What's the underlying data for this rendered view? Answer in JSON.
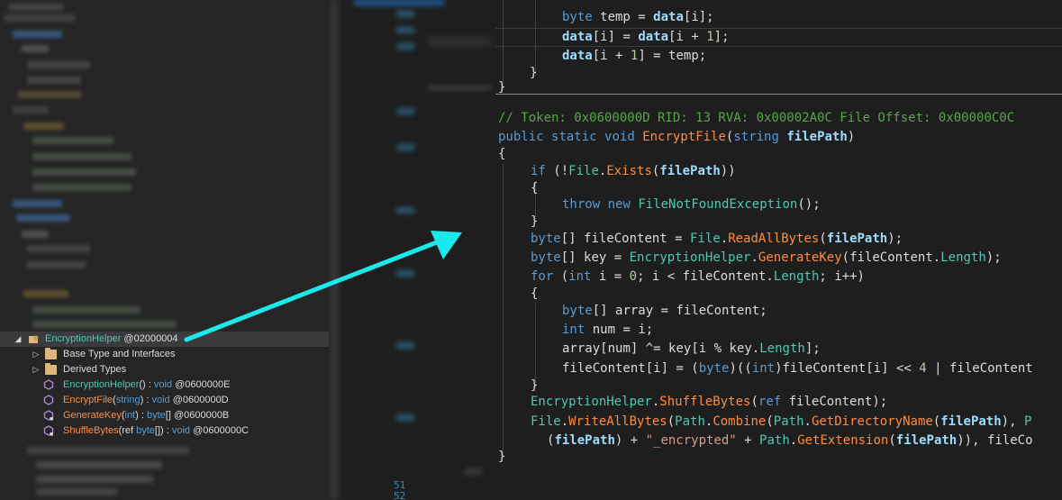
{
  "tree": {
    "nodes": [
      {
        "expander": "◢",
        "label": "EncryptionHelper",
        "suffix": " @02000004",
        "kind": "class"
      },
      {
        "expander": "▷",
        "label": "Base Type and Interfaces",
        "kind": "folder"
      },
      {
        "expander": "▷",
        "label": "Derived Types",
        "kind": "folder"
      },
      {
        "name": "EncryptionHelper",
        "args": "()",
        "sep": " : ",
        "ret": "void",
        "token": " @0600000E"
      },
      {
        "name": "EncryptFile",
        "args_open": "(",
        "args_type": "string",
        "args_close": ")",
        "sep": " : ",
        "ret": "void",
        "token": " @0600000D"
      },
      {
        "name": "GenerateKey",
        "args_open": "(",
        "args_type": "int",
        "args_close": ")",
        "sep": " : ",
        "ret": "byte",
        "ret_suffix": "[]",
        "token": " @0600000B"
      },
      {
        "name": "ShuffleBytes",
        "args_open": "(ref ",
        "args_type": "byte",
        "args_close": "[])",
        "sep": " : ",
        "ret": "void",
        "token": " @0600000C"
      }
    ]
  },
  "gutter": {
    "line_a": "51",
    "line_b": "52"
  },
  "code": {
    "l1": [
      "byte",
      " temp = ",
      "data",
      "[",
      "i",
      "];"
    ],
    "l2": [
      "data",
      "[",
      "i",
      "] = ",
      "data",
      "[",
      "i",
      " + ",
      "1",
      "];"
    ],
    "l3": [
      "data",
      "[",
      "i",
      " + ",
      "1",
      "] = ",
      "temp",
      ";"
    ],
    "l4": "}",
    "l5": "}",
    "comment": "// Token: 0x0600000D RID: 13 RVA: 0x00002A0C File Offset: 0x00000C0C",
    "sig": [
      "public",
      " ",
      "static",
      " ",
      "void",
      " ",
      "EncryptFile",
      "(",
      "string",
      " ",
      "filePath",
      ")"
    ],
    "open1": "{",
    "if": [
      "if",
      " (!",
      "File",
      ".",
      "Exists",
      "(",
      "filePath",
      "))"
    ],
    "open2": "{",
    "throw": [
      "throw",
      " ",
      "new",
      " ",
      "FileNotFoundException",
      "();"
    ],
    "close2": "}",
    "fc": [
      "byte",
      "[] ",
      "fileContent",
      " = ",
      "File",
      ".",
      "ReadAllBytes",
      "(",
      "filePath",
      ");"
    ],
    "key": [
      "byte",
      "[] ",
      "key",
      " = ",
      "EncryptionHelper",
      ".",
      "GenerateKey",
      "(",
      "fileContent",
      ".",
      "Length",
      ");"
    ],
    "for": [
      "for",
      " (",
      "int",
      " ",
      "i",
      " = ",
      "0",
      "; ",
      "i",
      " < ",
      "fileContent",
      ".",
      "Length",
      "; ",
      "i",
      "++)"
    ],
    "open3": "{",
    "arr": [
      "byte",
      "[] ",
      "array",
      " = ",
      "fileContent",
      ";"
    ],
    "num": [
      "int",
      " ",
      "num",
      " = ",
      "i",
      ";"
    ],
    "xor": [
      "array",
      "[",
      "num",
      "] ^= ",
      "key",
      "[",
      "i",
      " % ",
      "key",
      ".",
      "Length",
      "];"
    ],
    "shift": [
      "fileContent",
      "[",
      "i",
      "] = (",
      "byte",
      ")((",
      "int",
      ")",
      "fileContent",
      "[",
      "i",
      "] << ",
      "4",
      " | ",
      "fileContent"
    ],
    "close3": "}",
    "shuffle": [
      "EncryptionHelper",
      ".",
      "ShuffleBytes",
      "(",
      "ref",
      " ",
      "fileContent",
      ");"
    ],
    "write": [
      "File",
      ".",
      "WriteAllBytes",
      "(",
      "Path",
      ".",
      "Combine",
      "(",
      "Path",
      ".",
      "GetDirectoryName",
      "(",
      "filePath",
      "), ",
      "P"
    ],
    "write2": [
      "(",
      "filePath",
      ") + ",
      "\"_encrypted\"",
      " + ",
      "Path",
      ".",
      "GetExtension",
      "(",
      "filePath",
      ")), ",
      "fileCo"
    ],
    "close1": "}"
  },
  "colors": {
    "arrow": "#1ae8ea",
    "keyword": "#569cd6",
    "type": "#4ec9b0",
    "method": "#ff8c3f",
    "comment": "#57a64a"
  }
}
